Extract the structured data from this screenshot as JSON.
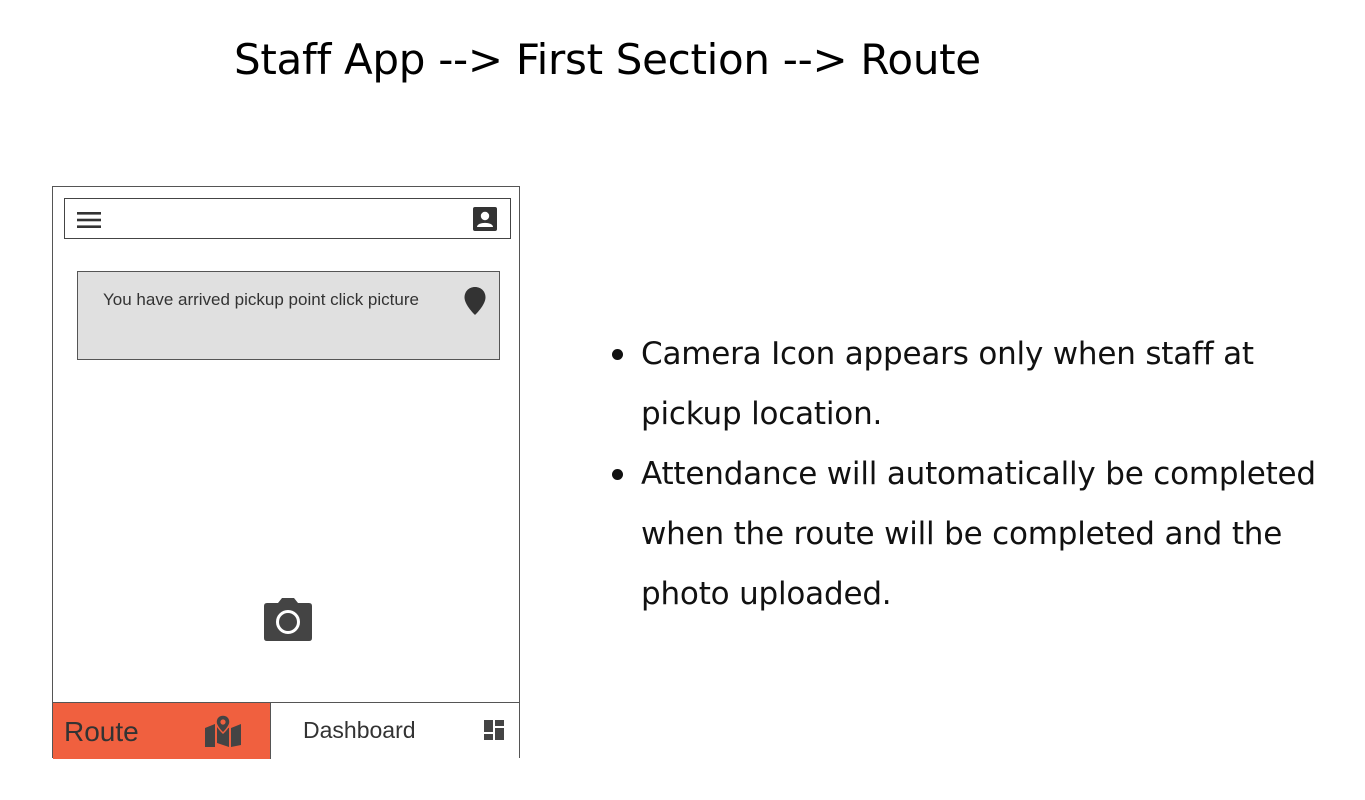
{
  "page": {
    "title": "Staff App --> First Section --> Route"
  },
  "phone": {
    "app_bar": {
      "menu_icon": "hamburger-menu-icon",
      "profile_icon": "profile-card-icon"
    },
    "notice": {
      "text": "You have arrived pickup point click picture",
      "icon": "location-pin-icon"
    },
    "camera": {
      "icon": "camera-icon"
    },
    "bottom_nav": {
      "items": [
        {
          "label": "Route",
          "icon": "map-icon",
          "active": true,
          "color": "#f0603f"
        },
        {
          "label": "Dashboard",
          "icon": "dashboard-icon",
          "active": false
        }
      ]
    }
  },
  "notes": {
    "items": [
      "Camera Icon appears only when staff at pickup location.",
      "Attendance will automatically be completed when the route will be completed and the photo uploaded."
    ]
  }
}
